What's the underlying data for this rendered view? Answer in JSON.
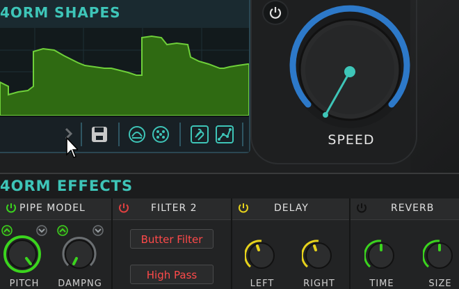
{
  "shapes": {
    "title": "4ORM SHAPES",
    "toolbar_icons": [
      "chevron-right-icon",
      "save-icon",
      "curve-shape-icon",
      "pattern-icon",
      "link-icon",
      "node-graph-icon"
    ]
  },
  "speed": {
    "label": "SPEED",
    "level": 0.56,
    "arc_color": "#2d79c9",
    "pointer_color": "#3ec5b8"
  },
  "effects": {
    "title": "4ORM EFFECTS",
    "modules": [
      {
        "title": "PIPE MODEL",
        "power_color": "#3bd41e",
        "knobs": [
          {
            "label": "PITCH"
          },
          {
            "label": "DAMPNG"
          }
        ]
      },
      {
        "title": "FILTER 2",
        "power_color": "#e04040",
        "buttons": [
          "Butter Filter",
          "High Pass"
        ]
      },
      {
        "title": "DELAY",
        "power_color": "#e6d21c",
        "knobs": [
          {
            "label": "LEFT"
          },
          {
            "label": "RIGHT"
          }
        ]
      },
      {
        "title": "REVERB",
        "power_color": "#2c2d2e",
        "knobs": [
          {
            "label": "TIME"
          },
          {
            "label": "SIZE"
          }
        ]
      }
    ]
  },
  "colors": {
    "accent": "#3ec5b8",
    "waveform_fill": "#2f6a12",
    "waveform_line": "#6fd03a",
    "green_knob": "#3bd41e",
    "yellow_knob": "#e6d21c",
    "red_text": "#ff4a4a"
  }
}
